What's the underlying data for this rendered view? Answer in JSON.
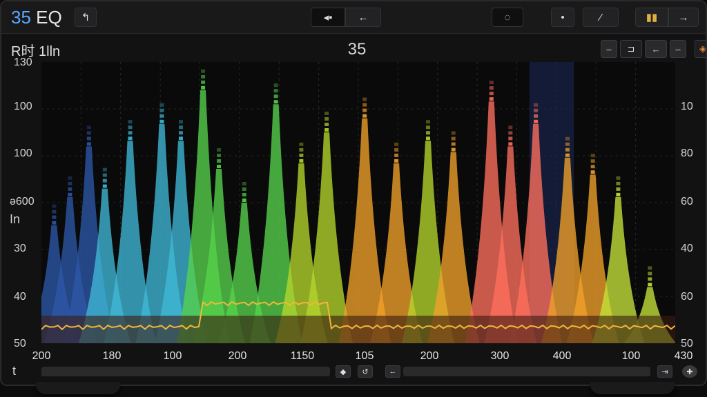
{
  "app": {
    "title_num": "35",
    "title_text": " EQ"
  },
  "toolbar": {
    "back_icon": "↰",
    "group1": [
      "◂▪",
      "←"
    ],
    "group2": [
      "◌",
      "•"
    ],
    "group3": [
      "⬢",
      "⁄"
    ],
    "group4": [
      "▮▮",
      "→"
    ]
  },
  "graph": {
    "label": "R时 1lln",
    "title": "35",
    "side_label_a": "ǝ600",
    "side_label_b": "In",
    "controls": [
      "–",
      "⊐",
      "←",
      "–",
      "◈"
    ]
  },
  "chart_data": {
    "type": "area",
    "y_left_ticks": [
      "130",
      "100",
      "100",
      "ǝ600",
      "30",
      "40",
      "50"
    ],
    "y_right_ticks": [
      "10",
      "80",
      "60",
      "40",
      "60",
      "50"
    ],
    "x_ticks": [
      "200",
      "180",
      "100",
      "200",
      "1150",
      "105",
      "200",
      "300",
      "400",
      "100",
      "430"
    ],
    "highlight_band_x": [
      0.77,
      0.84
    ],
    "colors": [
      "#2d57a8",
      "#3fb9d6",
      "#56d34c",
      "#b5d62b",
      "#f2a12a",
      "#ff6f5e",
      "#c4e33a"
    ],
    "peaks": [
      {
        "x": 0.02,
        "h": 0.42,
        "c": 0
      },
      {
        "x": 0.045,
        "h": 0.52,
        "c": 0
      },
      {
        "x": 0.075,
        "h": 0.7,
        "c": 0
      },
      {
        "x": 0.1,
        "h": 0.55,
        "c": 1
      },
      {
        "x": 0.14,
        "h": 0.72,
        "c": 1
      },
      {
        "x": 0.19,
        "h": 0.78,
        "c": 1
      },
      {
        "x": 0.22,
        "h": 0.72,
        "c": 1
      },
      {
        "x": 0.255,
        "h": 0.9,
        "c": 2
      },
      {
        "x": 0.28,
        "h": 0.62,
        "c": 2
      },
      {
        "x": 0.32,
        "h": 0.5,
        "c": 2
      },
      {
        "x": 0.37,
        "h": 0.85,
        "c": 2
      },
      {
        "x": 0.41,
        "h": 0.64,
        "c": 3
      },
      {
        "x": 0.45,
        "h": 0.75,
        "c": 3
      },
      {
        "x": 0.51,
        "h": 0.8,
        "c": 4
      },
      {
        "x": 0.56,
        "h": 0.64,
        "c": 4
      },
      {
        "x": 0.61,
        "h": 0.72,
        "c": 3
      },
      {
        "x": 0.65,
        "h": 0.68,
        "c": 4
      },
      {
        "x": 0.71,
        "h": 0.86,
        "c": 5
      },
      {
        "x": 0.74,
        "h": 0.7,
        "c": 5
      },
      {
        "x": 0.78,
        "h": 0.78,
        "c": 5
      },
      {
        "x": 0.83,
        "h": 0.66,
        "c": 4
      },
      {
        "x": 0.87,
        "h": 0.6,
        "c": 4
      },
      {
        "x": 0.91,
        "h": 0.52,
        "c": 6
      },
      {
        "x": 0.96,
        "h": 0.2,
        "c": 6
      }
    ]
  },
  "bottombar": {
    "left_label": "t",
    "btn1": "◆",
    "btn2": "↺",
    "btn3": "←",
    "btn4": "⇥",
    "btn5": "✚"
  }
}
